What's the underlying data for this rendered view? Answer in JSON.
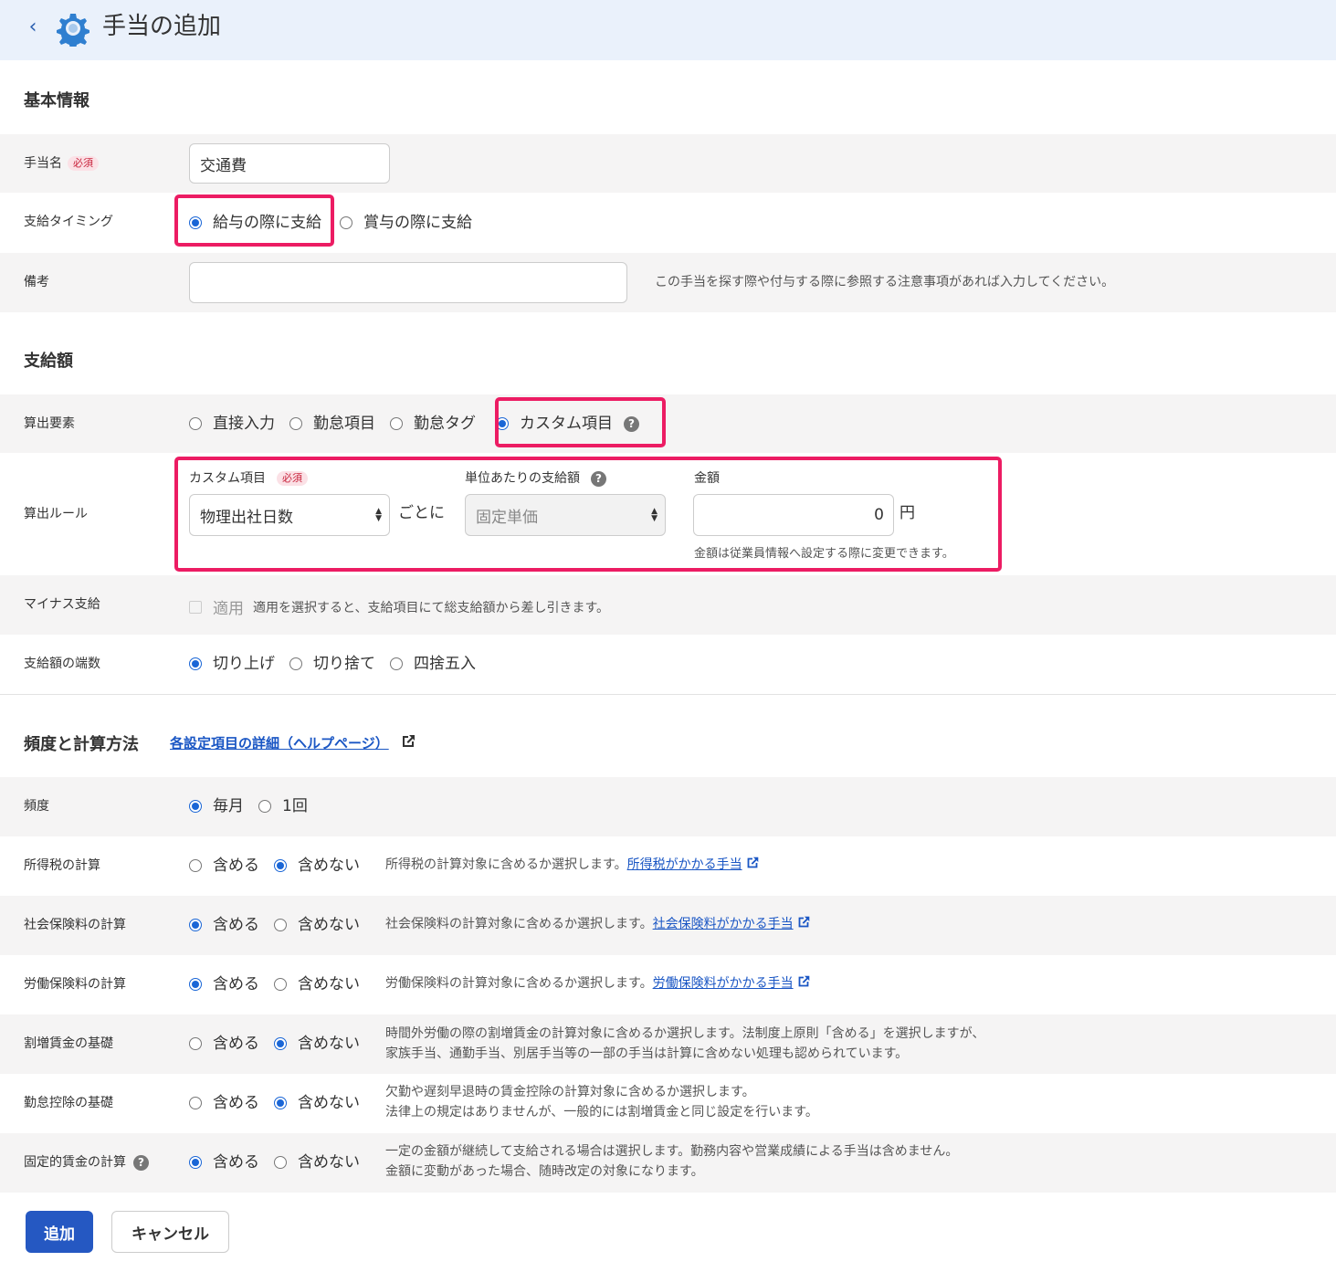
{
  "header": {
    "title": "手当の追加",
    "back_icon": "chevron-left-icon",
    "settings_icon": "gear-icon"
  },
  "basic": {
    "section_title": "基本情報",
    "name_label": "手当名",
    "required_badge": "必須",
    "name_value": "交通費",
    "timing_label": "支給タイミング",
    "timing_options": [
      "給与の際に支給",
      "賞与の際に支給"
    ],
    "remarks_label": "備考",
    "remarks_value": "",
    "remarks_note": "この手当を探す際や付与する際に参照する注意事項があれば入力してください。"
  },
  "amount": {
    "section_title": "支給額",
    "element_label": "算出要素",
    "element_options": [
      "直接入力",
      "勤怠項目",
      "勤怠タグ",
      "カスタム項目"
    ],
    "rule_label": "算出ルール",
    "custom_item_label": "カスタム項目",
    "custom_item_value": "物理出社日数",
    "per_text": "ごとに",
    "unit_label": "単位あたりの支給額",
    "unit_value": "固定単価",
    "money_label": "金額",
    "money_value": "0",
    "yen": "円",
    "money_note": "金額は従業員情報へ設定する際に変更できます。",
    "minus_label": "マイナス支給",
    "minus_check_label": "適用",
    "minus_note": "適用を選択すると、支給項目にて総支給額から差し引きます。",
    "rounding_label": "支給額の端数",
    "rounding_options": [
      "切り上げ",
      "切り捨て",
      "四捨五入"
    ]
  },
  "frequency": {
    "section_title": "頻度と計算方法",
    "help_link": "各設定項目の詳細（ヘルプページ）",
    "freq_label": "頻度",
    "freq_options": [
      "毎月",
      "1回"
    ],
    "include": "含める",
    "exclude": "含めない",
    "income_tax_label": "所得税の計算",
    "income_tax_note": "所得税の計算対象に含めるか選択します。",
    "income_tax_link": "所得税がかかる手当",
    "social_label": "社会保険料の計算",
    "social_note": "社会保険料の計算対象に含めるか選択します。",
    "social_link": "社会保険料がかかる手当",
    "labor_label": "労働保険料の計算",
    "labor_note": "労働保険料の計算対象に含めるか選択します。",
    "labor_link": "労働保険料がかかる手当",
    "overtime_label": "割増賃金の基礎",
    "overtime_note_1": "時間外労働の際の割増賃金の計算対象に含めるか選択します。法制度上原則「含める」を選択しますが、",
    "overtime_note_2": "家族手当、通勤手当、別居手当等の一部の手当は計算に含めない処理も認められています。",
    "deduction_label": "勤怠控除の基礎",
    "deduction_note_1": "欠勤や遅刻早退時の賃金控除の計算対象に含めるか選択します。",
    "deduction_note_2": "法律上の規定はありませんが、一般的には割増賃金と同じ設定を行います。",
    "fixed_label": "固定的賃金の計算",
    "fixed_note_1": "一定の金額が継続して支給される場合は選択します。勤務内容や営業成績による手当は含めません。",
    "fixed_note_2": "金額に変動があった場合、随時改定の対象になります。"
  },
  "actions": {
    "submit": "追加",
    "cancel": "キャンセル"
  },
  "colors": {
    "accent": "#1a66d6",
    "highlight": "#ec1c63",
    "header_bg": "#eaf1fb",
    "primary_button": "#2558c2"
  }
}
